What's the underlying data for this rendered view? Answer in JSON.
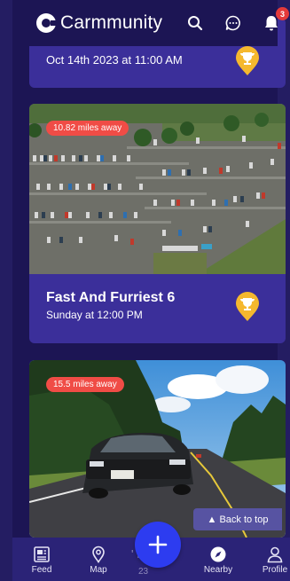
{
  "header": {
    "brand": "Carmmunity",
    "notification_count": "3",
    "icons": [
      "search-icon",
      "chat-icon",
      "bell-icon"
    ]
  },
  "events": [
    {
      "date": "Oct 14th 2023 at 11:00 AM",
      "icon": "trophy-icon"
    },
    {
      "distance": "10.82 miles away",
      "title": "Fast And Furriest 6",
      "date": "Sunday at 12:00 PM",
      "icon": "trophy-icon"
    },
    {
      "distance": "15.5 miles away"
    }
  ],
  "back_to_top": "▲ Back to top",
  "bottom_nav": {
    "items": [
      {
        "label": "Feed",
        "icon": "feed-icon"
      },
      {
        "label": "Map",
        "icon": "map-pin-icon"
      },
      {
        "label": "Nearby",
        "icon": "compass-icon"
      },
      {
        "label": "Profile",
        "icon": "profile-icon"
      }
    ],
    "partial_text": "' R       al",
    "partial_text2": "23",
    "fab_icon": "plus-icon"
  },
  "colors": {
    "background": "#1c1554",
    "card": "#3b2f9a",
    "badge": "#e43a3a",
    "distance_pill": "#f04c46",
    "trophy": "#f5b82e",
    "fab": "#2d3cf0",
    "nav": "#2b2377"
  }
}
